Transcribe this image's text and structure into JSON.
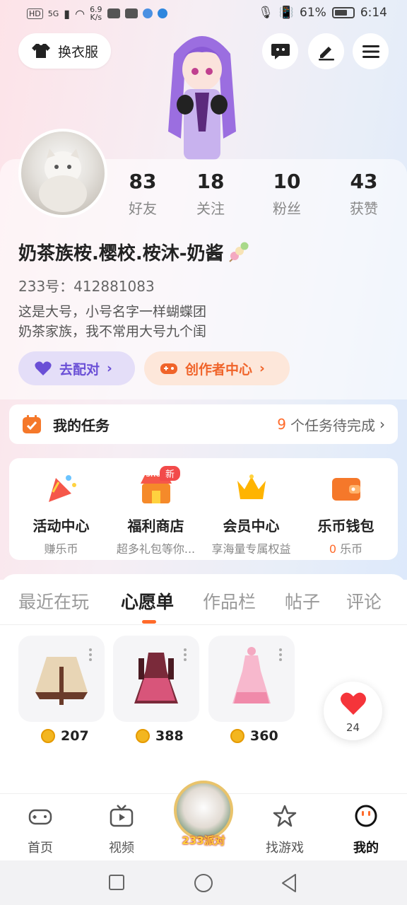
{
  "status_bar": {
    "hd": "HD",
    "sig": "5G",
    "speed": "6.9",
    "speed_unit": "K/s",
    "battery": "61%",
    "time": "6:14"
  },
  "header": {
    "outfit_button": "换衣服"
  },
  "profile": {
    "stats": [
      {
        "num": "83",
        "label": "好友"
      },
      {
        "num": "18",
        "label": "关注"
      },
      {
        "num": "10",
        "label": "粉丝"
      },
      {
        "num": "43",
        "label": "获赞"
      }
    ],
    "nickname": "奶茶族桉.樱校.桉沐-奶酱",
    "uid": "233号：412881083",
    "bio_line1": "这是大号，小号名字一样蝴蝶团",
    "bio_line2": "奶茶家族，我不常用大号九个闺",
    "match_button": "去配对",
    "creator_button": "创作者中心"
  },
  "tasks": {
    "title": "我的任务",
    "count": "9",
    "suffix": "个任务待完成"
  },
  "services": [
    {
      "title": "活动中心",
      "sub": "赚乐币"
    },
    {
      "title": "福利商店",
      "sub": "超多礼包等你..."
    },
    {
      "title": "会员中心",
      "sub": "享海量专属权益"
    },
    {
      "title": "乐币钱包",
      "sub_num": "0",
      "sub": "乐币"
    }
  ],
  "shop_badge": "新",
  "shop_sign": "SHOP",
  "tabs": [
    "最近在玩",
    "心愿单",
    "作品栏",
    "帖子",
    "评论"
  ],
  "wishlist": [
    {
      "price": "207"
    },
    {
      "price": "388"
    },
    {
      "price": "360"
    }
  ],
  "like_count": "24",
  "bottom_nav": {
    "home": "首页",
    "video": "视频",
    "party": "233派对",
    "find": "找游戏",
    "me": "我的"
  },
  "colors": {
    "accent": "#ff6a2a",
    "match_bg": "#e4def8",
    "creator_bg": "#fde7da"
  }
}
